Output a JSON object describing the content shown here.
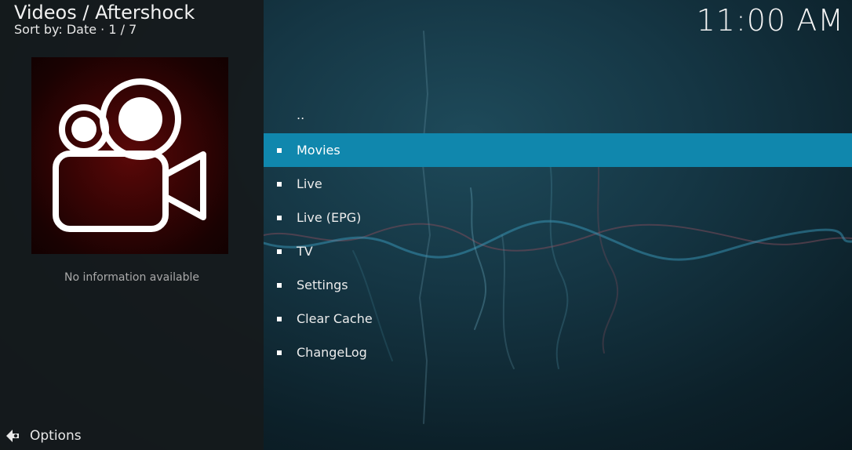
{
  "header": {
    "title": "Videos / Aftershock",
    "sort_info": "Sort by: Date  ·  1 / 7"
  },
  "clock": "11:00 AM",
  "info_panel": {
    "no_info_text": "No information available"
  },
  "footer": {
    "options_label": "Options"
  },
  "list": {
    "items": [
      {
        "label": "..",
        "bullet": false,
        "selected": false
      },
      {
        "label": "Movies",
        "bullet": true,
        "selected": true
      },
      {
        "label": "Live",
        "bullet": true,
        "selected": false
      },
      {
        "label": "Live (EPG)",
        "bullet": true,
        "selected": false
      },
      {
        "label": "TV",
        "bullet": true,
        "selected": false
      },
      {
        "label": "Settings",
        "bullet": true,
        "selected": false
      },
      {
        "label": "Clear Cache",
        "bullet": true,
        "selected": false
      },
      {
        "label": "ChangeLog",
        "bullet": true,
        "selected": false
      }
    ]
  },
  "colors": {
    "selection": "#1087ad",
    "thumbnail_bg": "#360404"
  },
  "icons": {
    "thumbnail": "movie-camera-icon",
    "options": "options-arrow-icon"
  }
}
